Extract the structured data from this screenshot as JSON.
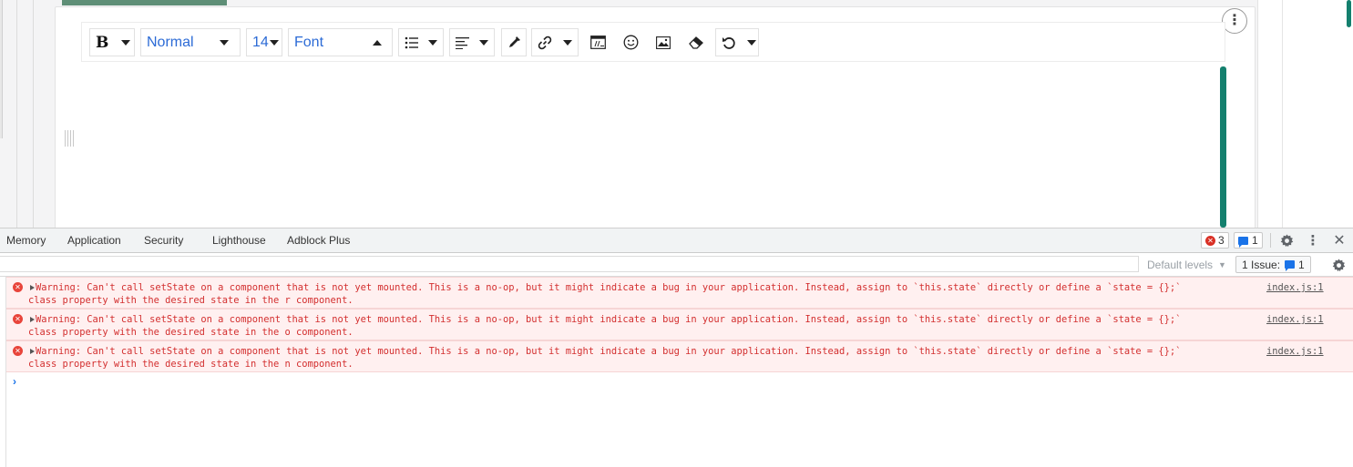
{
  "editor": {
    "toolbar": {
      "bold_label": "B",
      "paragraph_style": "Normal",
      "font_size": "14",
      "font_family": "Font"
    },
    "more_icon": "vertical-ellipsis-icon"
  },
  "devtools": {
    "tabs": [
      {
        "label": "Memory"
      },
      {
        "label": "Application"
      },
      {
        "label": "Security"
      },
      {
        "label": "Lighthouse"
      },
      {
        "label": "Adblock Plus"
      }
    ],
    "error_count": "3",
    "message_count": "1",
    "filter": {
      "placeholder": "",
      "value": ""
    },
    "levels_label": "Default levels",
    "issues_label": "1 Issue:",
    "issues_count": "1",
    "messages": [
      {
        "line1": "Warning: Can't call setState on a component that is not yet mounted. This is a no-op, but it might indicate a bug in your application. Instead, assign to `this.state` directly or define a `state = {};`",
        "line2": "class property with the desired state in the r component.",
        "source": "index.js:1"
      },
      {
        "line1": "Warning: Can't call setState on a component that is not yet mounted. This is a no-op, but it might indicate a bug in your application. Instead, assign to `this.state` directly or define a `state = {};`",
        "line2": "class property with the desired state in the o component.",
        "source": "index.js:1"
      },
      {
        "line1": "Warning: Can't call setState on a component that is not yet mounted. This is a no-op, but it might indicate a bug in your application. Instead, assign to `this.state` directly or define a `state = {};`",
        "line2": "class property with the desired state in the n component.",
        "source": "index.js:1"
      }
    ],
    "prompt_symbol": "›"
  },
  "colors": {
    "accent_green": "#14806e",
    "link_blue": "#2c6bd6",
    "error_red": "#d32f2f",
    "error_bg": "#fff0f0"
  }
}
